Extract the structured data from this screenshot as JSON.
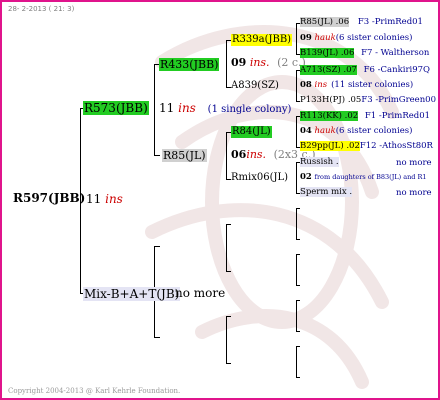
{
  "header": {
    "date": "28-  2-2013 ( 21:  3)"
  },
  "footer": {
    "copyright": "Copyright 2004-2013 @ Karl Kehrle Foundation."
  },
  "root": {
    "id": "R597(JBB)",
    "count": "11",
    "ins": "ins"
  },
  "gen1": {
    "upper": {
      "id": "R573(JBB)",
      "count": "11",
      "ins": "ins",
      "note": "(1 single colony)"
    },
    "lower": {
      "id": "Mix-B+A+T(JB)",
      "more": "no more"
    }
  },
  "gen2": {
    "a": {
      "id": "R433(JBB)",
      "count": "09",
      "ins": "ins.",
      "note": "(2 c.)"
    },
    "b": {
      "id": "R85(JL)",
      "count": "06",
      "ins": "ins.",
      "note": "(2x3 c.)"
    }
  },
  "gen3": {
    "a1": {
      "id": "R339a(JBB)"
    },
    "a2": {
      "id": "A839(SZ)"
    },
    "b1": {
      "id": "R84(JL)"
    },
    "b2": {
      "id": "Rmix06(JL)"
    }
  },
  "gen4": {
    "r1": {
      "id": "R85(JL) .06",
      "code": "F3 -PrimRed01"
    },
    "r2": {
      "count": "09",
      "ins": "hauk",
      "note": "(6 sister colonies)"
    },
    "r3": {
      "id": "B139(JL) .06",
      "code": "F7 - Waltherson"
    },
    "r4": {
      "id": "A713(SZ) .07",
      "code": "F6 -Cankiri97Q"
    },
    "r5": {
      "count": "08",
      "ins": "ins",
      "note": "(11 sister colonies)"
    },
    "r6": {
      "id": "P133H(PJ) .05",
      "code": "F3 -PrimGreen00"
    },
    "r7": {
      "id": "R113(KK) .02",
      "code": "F1 -PrimRed01"
    },
    "r8": {
      "count": "04",
      "ins": "hauk",
      "note": "(6 sister colonies)"
    },
    "r9": {
      "id": "B29pp(JL) .02",
      "code": "F12 -AthosSt80R"
    },
    "r10": {
      "id": "Russish .",
      "more": "no more"
    },
    "r11": {
      "count": "02",
      "note": "from daughters of B83(JL) and R1"
    },
    "r12": {
      "id": "Sperm mix .",
      "more": "no more"
    }
  }
}
